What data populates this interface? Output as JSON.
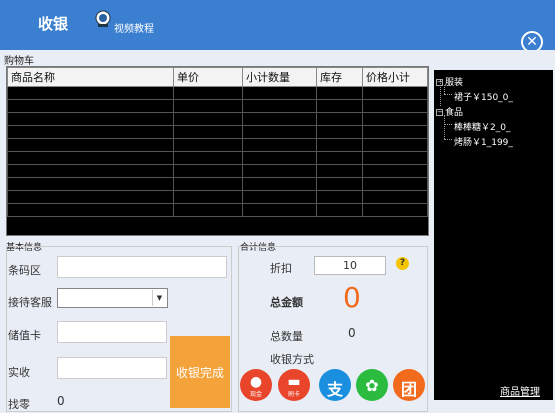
{
  "header": {
    "title": "收银",
    "video_tutorial": "视频教程"
  },
  "cart": {
    "label": "购物车",
    "columns": [
      "商品名称",
      "单价",
      "小计数量",
      "库存",
      "价格小计"
    ]
  },
  "tree": {
    "categories": [
      {
        "label": "服装",
        "items": [
          "裙子￥150_0_"
        ]
      },
      {
        "label": "食品",
        "items": [
          "棒棒糖￥2_0_",
          "烤肠￥1_199_"
        ]
      }
    ],
    "manage_link": "商品管理"
  },
  "basic_info": {
    "label": "基本信息",
    "barcode": "条码区",
    "staff": "接待客服",
    "card": "储值卡",
    "received": "实收",
    "change": "找零",
    "change_value": "0",
    "pay_button": "收银完成"
  },
  "totals": {
    "label": "合计信息",
    "discount": "折扣",
    "discount_value": "10",
    "amount": "总金额",
    "amount_value": "0",
    "count": "总数量",
    "count_value": "0",
    "method": "收银方式",
    "help": "?"
  },
  "payment_methods": [
    {
      "name": "cash",
      "label": "现金",
      "color": "#e8452a"
    },
    {
      "name": "card",
      "label": "刷卡",
      "color": "#e8452a"
    },
    {
      "name": "alipay",
      "glyph": "支",
      "color": "#1a8fe0"
    },
    {
      "name": "wechat",
      "glyph": "✿",
      "color": "#2bbb3f"
    },
    {
      "name": "groupbuy",
      "glyph": "团",
      "color": "#f26b1d"
    }
  ],
  "close_symbol": "✕"
}
